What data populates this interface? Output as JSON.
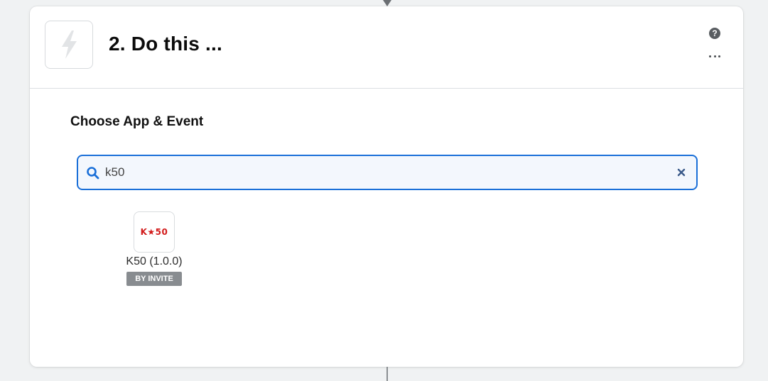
{
  "step": {
    "title": "2. Do this ...",
    "icon": "lightning-bolt-icon"
  },
  "header_actions": {
    "help_icon": "question-circle-icon",
    "help_glyph": "?",
    "more_icon": "ellipsis-icon"
  },
  "section": {
    "title": "Choose App & Event"
  },
  "search": {
    "value": "k50",
    "icon": "search-icon",
    "clear_icon": "close-icon"
  },
  "results": [
    {
      "logo_text": "K★50",
      "name": "K50 (1.0.0)",
      "badge": "BY INVITE"
    }
  ],
  "colors": {
    "accent": "#1a6fd8",
    "logo_red": "#d21b1b",
    "badge_gray": "#888c90"
  }
}
